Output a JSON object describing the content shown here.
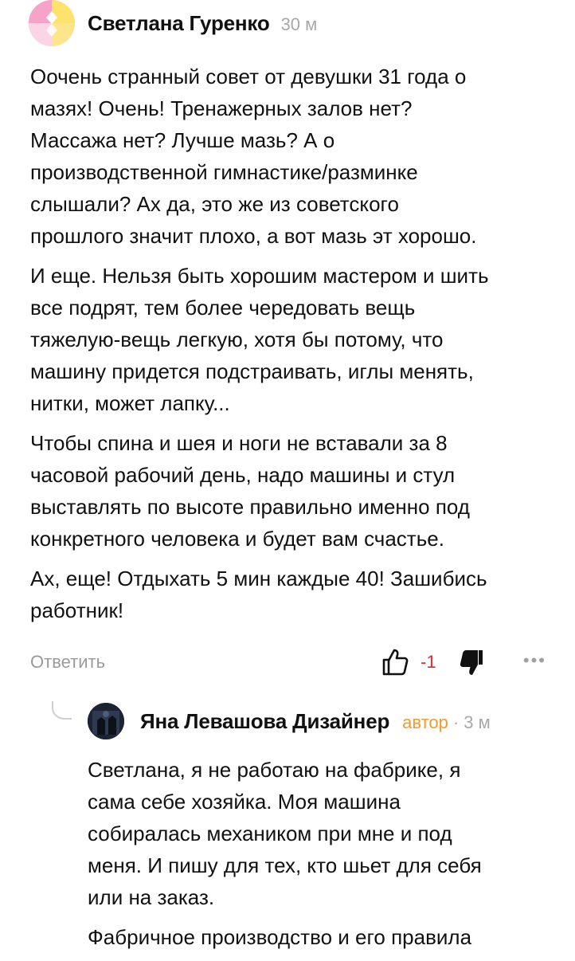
{
  "comment": {
    "author": "Светлана Гуренко",
    "time": "30 м",
    "paragraphs": [
      [
        "Оочень странный совет от девушки 31 года о",
        "мазях! Очень! Тренажерных залов нет?",
        "Массажа нет? Лучше мазь? А о",
        "производственной гимнастике/разминке",
        "слышали? Ах да, это же из советского",
        "прошлого значит плохо, а вот мазь эт хорошо."
      ],
      [
        "И еще. Нельзя быть хорошим мастером и шить",
        "все подрят, тем более чередовать вещь",
        "тяжелую-вещь легкую, хотя бы потому, что",
        "машину придется подстраивать, иглы менять,",
        "нитки, может лапку..."
      ],
      [
        "Чтобы спина и шея и ноги не вставали за 8",
        "часовой рабочий день, надо машины и стул",
        "выставлять по высоте правильно именно под",
        "конкретного человека и будет вам счастье."
      ],
      [
        "Ах, еще! Отдыхать 5 мин каждые 40! Зашибись",
        "работник!"
      ]
    ],
    "actions": {
      "reply_label": "Ответить",
      "score": "-1",
      "like_icon": "thumb-up-outline-icon",
      "dislike_icon": "thumb-down-filled-icon",
      "more_label": "•••"
    }
  },
  "reply": {
    "author": "Яна Левашова Дизайнер",
    "badge": "автор",
    "separator": "·",
    "time": "3 м",
    "paragraphs": [
      [
        "Светлана, я не работаю на фабрике, я",
        "сама себе хозяйка. Моя машина",
        "собиралась механиком при мне и под",
        "меня. И пишу для тех, кто шьет для себя",
        "или на заказ."
      ],
      [
        "Фабричное производство и его правила"
      ]
    ]
  },
  "colors": {
    "score_negative": "#e0282e",
    "author_badge": "#f39a2b",
    "muted": "#a8a8a8"
  }
}
